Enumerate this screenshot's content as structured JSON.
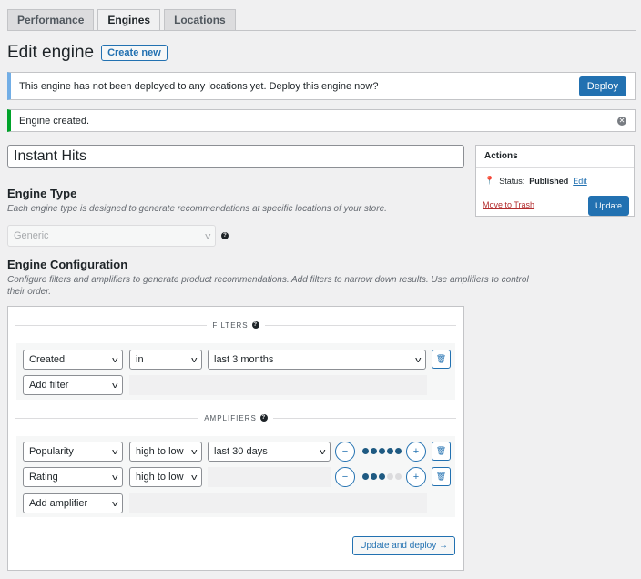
{
  "tabs": [
    {
      "label": "Performance",
      "active": false
    },
    {
      "label": "Engines",
      "active": true
    },
    {
      "label": "Locations",
      "active": false
    }
  ],
  "page": {
    "title": "Edit engine",
    "create_new": "Create new"
  },
  "notices": {
    "deploy_message": "This engine has not been deployed to any locations yet. Deploy this engine now?",
    "deploy_button": "Deploy",
    "created_message": "Engine created."
  },
  "engine_name": "Instant Hits",
  "engine_type": {
    "title": "Engine Type",
    "description": "Each engine type is designed to generate recommendations at specific locations of your store.",
    "selected": "Generic"
  },
  "configuration": {
    "title": "Engine Configuration",
    "description_1": "Configure filters and amplifiers to generate product recommendations. Add filters to narrow down results. Use amplifiers to control",
    "description_2": "their order.",
    "filters_label": "FILTERS",
    "filters": [
      {
        "field": "Created",
        "operator": "in",
        "value": "last 3 months"
      }
    ],
    "add_filter": "Add filter",
    "amplifiers_label": "AMPLIFIERS",
    "amplifiers": [
      {
        "field": "Popularity",
        "order": "high to low",
        "range": "last 30 days",
        "weight": 5,
        "max": 5
      },
      {
        "field": "Rating",
        "order": "high to low",
        "range": "",
        "weight": 3,
        "max": 5
      }
    ],
    "add_amplifier": "Add amplifier",
    "submit": "Update and deploy →"
  },
  "actions": {
    "title": "Actions",
    "status_label": "Status:",
    "status_value": "Published",
    "edit": "Edit",
    "trash": "Move to Trash",
    "update": "Update"
  },
  "colors": {
    "primary": "#2271b1",
    "info": "#72aee6",
    "success": "#00a32a",
    "danger": "#b32d2e"
  }
}
